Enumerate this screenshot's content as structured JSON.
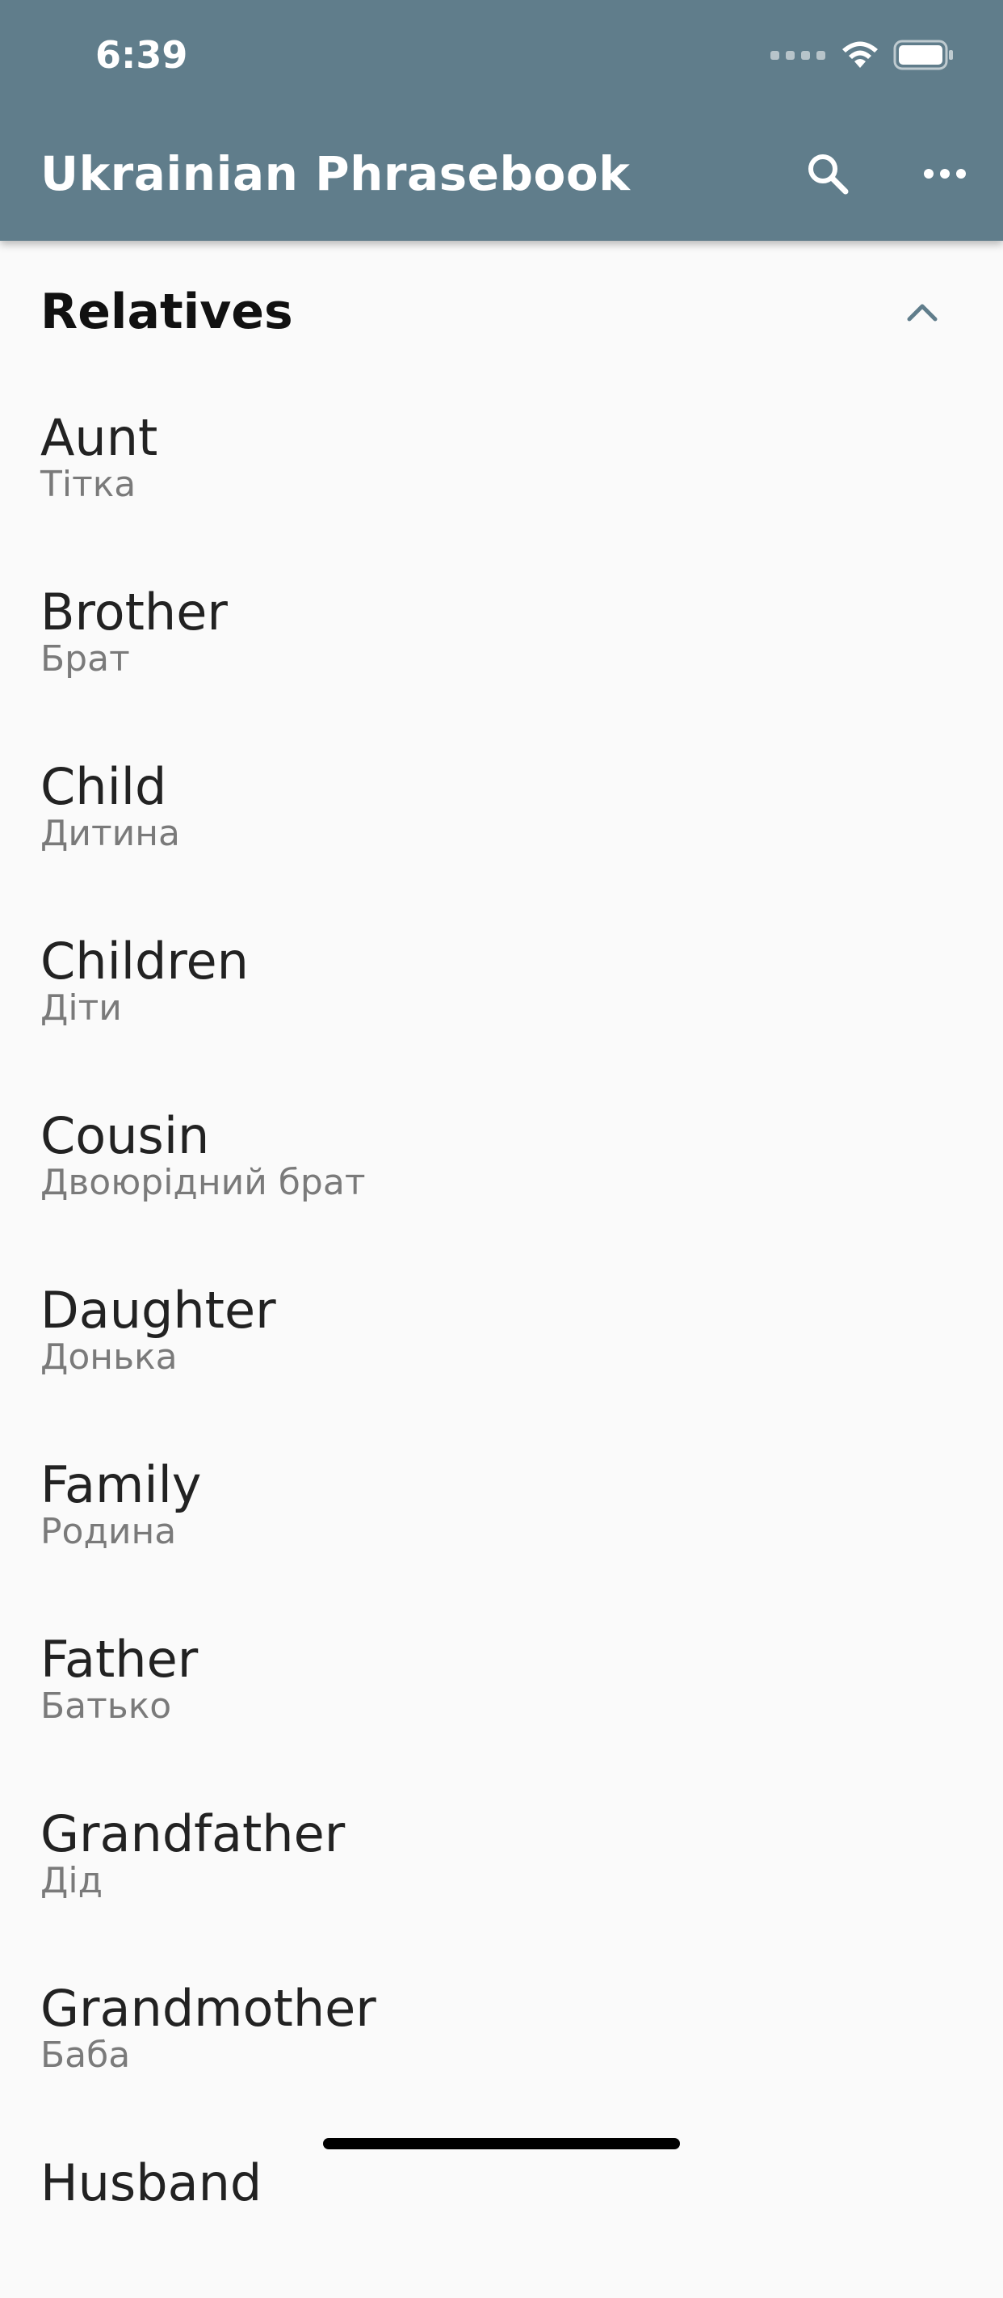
{
  "status_bar": {
    "time": "6:39"
  },
  "app_bar": {
    "title": "Ukrainian Phrasebook",
    "background_color": "#607d8b",
    "search_icon": "search-icon",
    "more_icon": "more-horizontal-icon"
  },
  "section": {
    "title": "Relatives",
    "expanded": true,
    "toggle_icon": "chevron-up-icon"
  },
  "phrases": [
    {
      "english": "Aunt",
      "ukrainian": "Тітка"
    },
    {
      "english": "Brother",
      "ukrainian": "Брат"
    },
    {
      "english": "Child",
      "ukrainian": "Дитина"
    },
    {
      "english": "Children",
      "ukrainian": "Діти"
    },
    {
      "english": "Cousin",
      "ukrainian": "Двоюрідний брат"
    },
    {
      "english": "Daughter",
      "ukrainian": "Донька"
    },
    {
      "english": "Family",
      "ukrainian": "Родина"
    },
    {
      "english": "Father",
      "ukrainian": "Батько"
    },
    {
      "english": "Grandfather",
      "ukrainian": "Дід"
    },
    {
      "english": "Grandmother",
      "ukrainian": "Баба"
    },
    {
      "english": "Husband",
      "ukrainian": ""
    }
  ]
}
